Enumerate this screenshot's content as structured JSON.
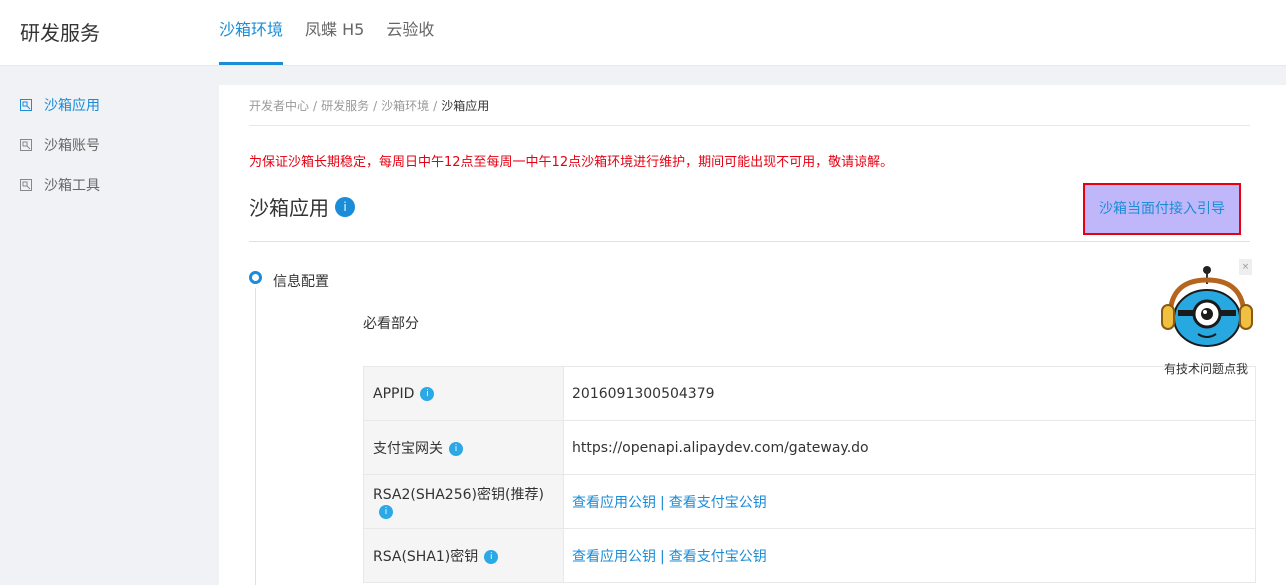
{
  "header": {
    "brand": "研发服务",
    "tabs": [
      {
        "label": "沙箱环境",
        "active": true
      },
      {
        "label": "凤蝶 H5",
        "active": false
      },
      {
        "label": "云验收",
        "active": false
      }
    ]
  },
  "sidebar": {
    "items": [
      {
        "label": "沙箱应用",
        "icon": "sandbox-icon",
        "active": true
      },
      {
        "label": "沙箱账号",
        "icon": "sandbox-icon",
        "active": false
      },
      {
        "label": "沙箱工具",
        "icon": "sandbox-icon",
        "active": false
      }
    ]
  },
  "breadcrumb": {
    "items": [
      "开发者中心",
      "研发服务",
      "沙箱环境",
      "沙箱应用"
    ],
    "separator": "/"
  },
  "notice": "为保证沙箱长期稳定，每周日中午12点至每周一中午12点沙箱环境进行维护，期间可能出现不可用，敬请谅解。",
  "page": {
    "title": "沙箱应用",
    "title_badge": "i",
    "guide_button": "沙箱当面付接入引导"
  },
  "step": {
    "title": "信息配置",
    "section": "必看部分"
  },
  "table": {
    "rows": [
      {
        "label": "APPID",
        "value": "2016091300504379",
        "type": "text"
      },
      {
        "label": "支付宝网关",
        "value": "https://openapi.alipaydev.com/gateway.do",
        "type": "text"
      },
      {
        "label": "RSA2(SHA256)密钥(推荐)",
        "link1": "查看应用公钥",
        "link2": "查看支付宝公钥",
        "sep": "|",
        "type": "links"
      },
      {
        "label": "RSA(SHA1)密钥",
        "link1": "查看应用公钥",
        "link2": "查看支付宝公钥",
        "sep": "|",
        "type": "links"
      }
    ],
    "info_glyph": "i"
  },
  "helper": {
    "label": "有技术问题点我",
    "close": "×"
  },
  "colors": {
    "accent": "#1b8cd7",
    "notice": "#e60012",
    "sidebar_bg": "#f0f2f5",
    "guide_bg": "#c0b7fa"
  }
}
